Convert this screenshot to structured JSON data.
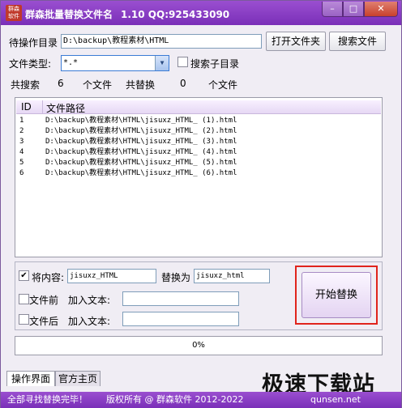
{
  "window": {
    "title": "群森批量替换文件名",
    "version": "1.10 QQ:925433090",
    "logo_text": "群森软件",
    "min_glyph": "–",
    "max_glyph": "□",
    "close_glyph": "✕"
  },
  "source": {
    "label": "待操作目录",
    "path": "D:\\backup\\教程素材\\HTML",
    "open_button": "打开文件夹",
    "search_button": "搜索文件"
  },
  "filetype": {
    "label": "文件类型:",
    "value": "*.*",
    "search_subdir_label": "搜索子目录",
    "search_subdir_checked": false
  },
  "stats": {
    "searched_label": "共搜索",
    "searched_count": "6",
    "searched_unit": "个文件",
    "replaced_label": "共替换",
    "replaced_count": "0",
    "replaced_unit": "个文件"
  },
  "list": {
    "col_id": "ID",
    "col_path": "文件路径",
    "rows": [
      {
        "id": "1",
        "path": "D:\\backup\\教程素材\\HTML\\jisuxz_HTML_ (1).html"
      },
      {
        "id": "2",
        "path": "D:\\backup\\教程素材\\HTML\\jisuxz_HTML_ (2).html"
      },
      {
        "id": "3",
        "path": "D:\\backup\\教程素材\\HTML\\jisuxz_HTML_ (3).html"
      },
      {
        "id": "4",
        "path": "D:\\backup\\教程素材\\HTML\\jisuxz_HTML_ (4).html"
      },
      {
        "id": "5",
        "path": "D:\\backup\\教程素材\\HTML\\jisuxz_HTML_ (5).html"
      },
      {
        "id": "6",
        "path": "D:\\backup\\教程素材\\HTML\\jisuxz_HTML_ (6).html"
      }
    ]
  },
  "replace": {
    "content_label": "将内容:",
    "content_value": "jisuxz_HTML",
    "content_checked": true,
    "replace_with_label": "替换为",
    "replace_with_value": "jisuxz_html",
    "prefix_label": "文件前",
    "prefix_checked": false,
    "prefix_add_label": "加入文本:",
    "prefix_value": "",
    "suffix_label": "文件后",
    "suffix_checked": false,
    "suffix_add_label": "加入文本:",
    "suffix_value": "",
    "start_button": "开始替换"
  },
  "progress": {
    "text": "0%",
    "value": 0
  },
  "tabs": {
    "active": "操作界面",
    "inactive": "官方主页"
  },
  "status": {
    "message": "全部寻找替换完毕！",
    "copyright": "版权所有 @ 群森软件 2012-2022"
  },
  "watermark": {
    "text": "极速下载站",
    "sub": "qunsen.net"
  }
}
